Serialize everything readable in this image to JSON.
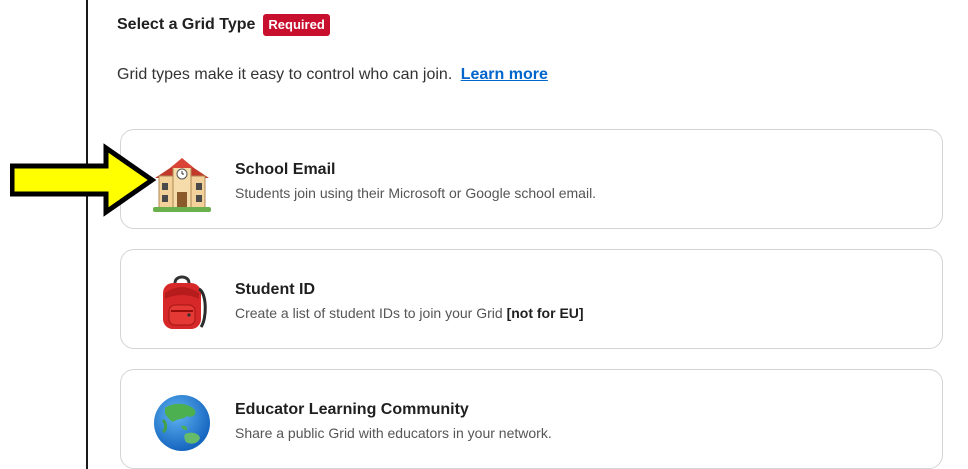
{
  "section": {
    "heading": "Select a Grid Type",
    "required_badge": "Required",
    "intro_text": "Grid types make it easy to control who can join.",
    "learn_more_label": "Learn more"
  },
  "options": [
    {
      "icon": "school-building-icon",
      "title": "School Email",
      "description": "Students join using their Microsoft or Google school email."
    },
    {
      "icon": "backpack-icon",
      "title": "Student ID",
      "description": "Create a list of student IDs to join your Grid",
      "description_strong": "[not for EU]"
    },
    {
      "icon": "globe-icon",
      "title": "Educator Learning Community",
      "description": "Share a public Grid with educators in your network."
    }
  ],
  "annotation": {
    "icon": "yellow-arrow-icon",
    "color": "#ffff00"
  },
  "colors": {
    "badge": "#c8102e",
    "link": "#0066cc",
    "card_border": "#d4d4d4"
  }
}
